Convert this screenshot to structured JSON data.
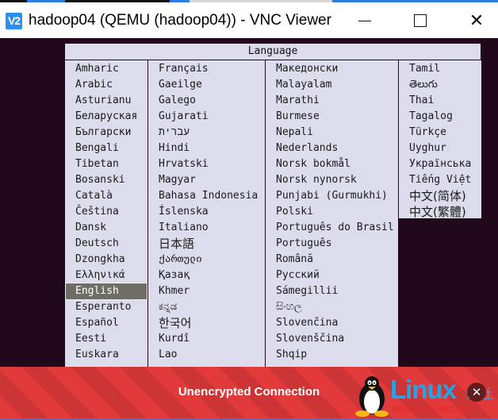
{
  "window": {
    "app_icon": "vnc-viewer-icon",
    "app_icon_text": "V2",
    "title": "hadoop04 (QEMU (hadoop04)) - VNC Viewer",
    "controls": {
      "minimize": "minimize-icon",
      "maximize": "maximize-icon",
      "close": "close-icon",
      "close_glyph": "✕"
    }
  },
  "language_menu": {
    "header": "Language",
    "selected": "English",
    "columns": [
      [
        "Amharic",
        "Arabic",
        "Asturianu",
        "Беларуская",
        "Български",
        "Bengali",
        "Tibetan",
        "Bosanski",
        "Català",
        "Čeština",
        "Dansk",
        "Deutsch",
        "Dzongkha",
        "Ελληνικά",
        "English",
        "Esperanto",
        "Español",
        "Eesti",
        "Euskara"
      ],
      [
        "Français",
        "Gaeilge",
        "Galego",
        "Gujarati",
        "עברית",
        "Hindi",
        "Hrvatski",
        "Magyar",
        "Bahasa Indonesia",
        "Íslenska",
        "Italiano",
        "日本語",
        "ქართული",
        "Қазақ",
        "Khmer",
        "ಕನ್ನಡ",
        "한국어",
        "Kurdî",
        "Lao"
      ],
      [
        "Македонски",
        "Malayalam",
        "Marathi",
        "Burmese",
        "Nepali",
        "Nederlands",
        "Norsk bokmål",
        "Norsk nynorsk",
        "Punjabi (Gurmukhi)",
        "Polski",
        "Português do Brasil",
        "Português",
        "Română",
        "Русский",
        "Sámegillii",
        "සිංහල",
        "Slovenčina",
        "Slovenščina",
        "Shqip"
      ],
      [
        "Tamil",
        "తెలుగు",
        "Thai",
        "Tagalog",
        "Türkçe",
        "Uyghur",
        "Українська",
        "Tiếng Việt",
        "中文(简体)",
        "中文(繁體)"
      ]
    ]
  },
  "banner": {
    "text": "Unencrypted Connection",
    "close_glyph": "✕",
    "colors": {
      "stripe_a": "#e23a3a",
      "stripe_b": "#cd3436"
    }
  },
  "watermark": {
    "brand": "Linux",
    "brand_cn": "公社",
    "url": "www.Linuxidc.com",
    "mascot": "tux-penguin-icon"
  }
}
